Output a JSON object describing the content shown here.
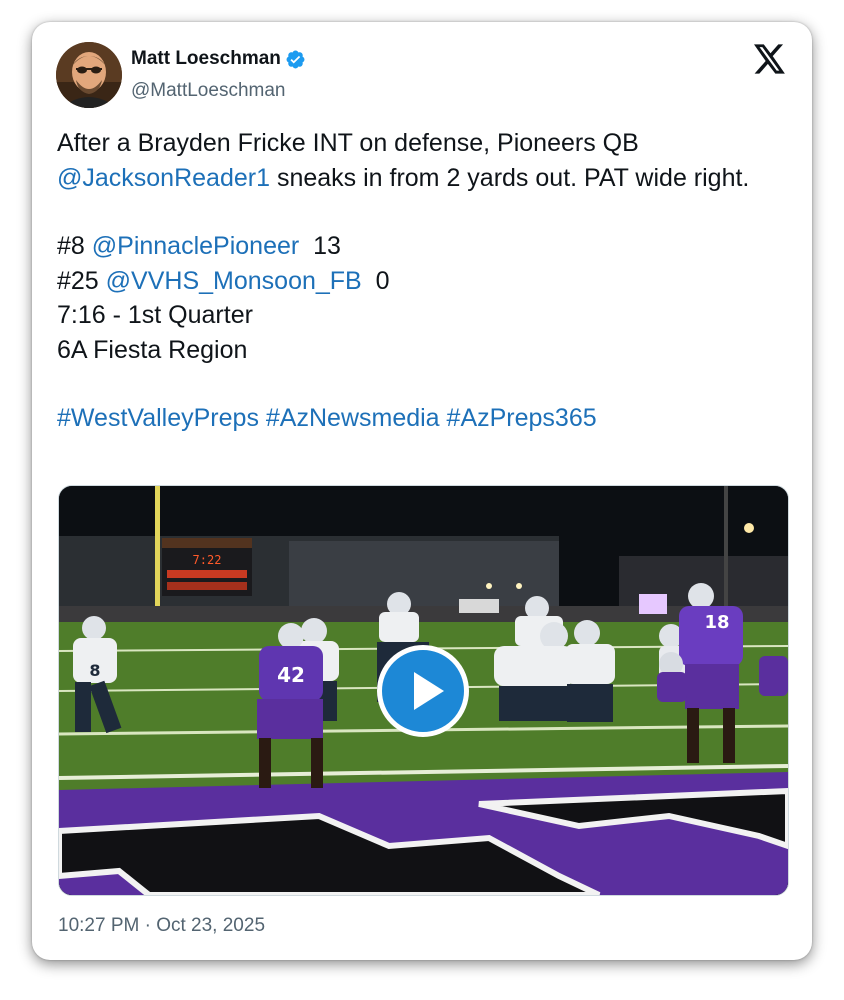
{
  "author": {
    "display_name": "Matt Loeschman",
    "handle": "@MattLoeschman",
    "verified": true
  },
  "tweet": {
    "line1_text": "After a Brayden Fricke INT on defense, Pioneers QB",
    "mention_qb": "@JacksonReader1",
    "line2_rest": " sneaks in from 2 yards out. PAT wide right.",
    "team1_rank": "#8 ",
    "team1_mention": "@PinnaclePioneer",
    "team1_score": "  13",
    "team2_rank": "#25 ",
    "team2_mention": "@VVHS_Monsoon_FB",
    "team2_score": "  0",
    "clock": "7:16 - 1st Quarter",
    "region": "6A Fiesta Region",
    "hashtags": [
      "#WestValleyPreps",
      "#AzNewsmedia",
      "#AzPreps365"
    ]
  },
  "media": {
    "type": "video",
    "play_icon": "play-icon",
    "scoreboard_clock": "7:22",
    "jersey_numbers": [
      "8",
      "42",
      "18"
    ]
  },
  "timestamp": "10:27 PM · Oct 23, 2025",
  "colors": {
    "link": "#1d70b8",
    "verified": "#1d9bf0",
    "play_button": "#1d88d6",
    "turf": "#4f7d2a",
    "end_zone": "#5a2f9e"
  },
  "icons": [
    "verified-badge-icon",
    "x-logo-icon",
    "play-icon"
  ]
}
